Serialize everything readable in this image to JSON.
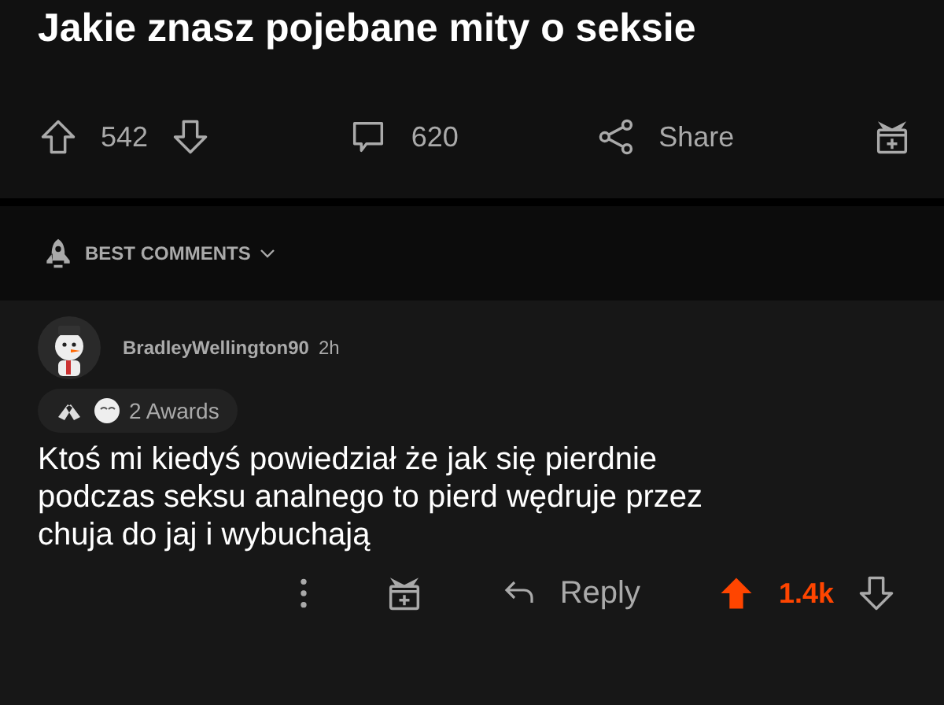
{
  "post": {
    "title": "Jakie znasz pojebane mity o seksie",
    "upvotes": "542",
    "comments": "620",
    "share": "Share"
  },
  "sort": {
    "label": "BEST COMMENTS"
  },
  "comment": {
    "author": "BradleyWellington90",
    "age": "2h",
    "awards": "2 Awards",
    "body": "Ktoś mi kiedyś powiedział że jak się pierdnie podczas seksu analnego to pierd wędruje przez chuja do jaj i wybuchają",
    "reply": "Reply",
    "score": "1.4k",
    "upvoted": true
  }
}
